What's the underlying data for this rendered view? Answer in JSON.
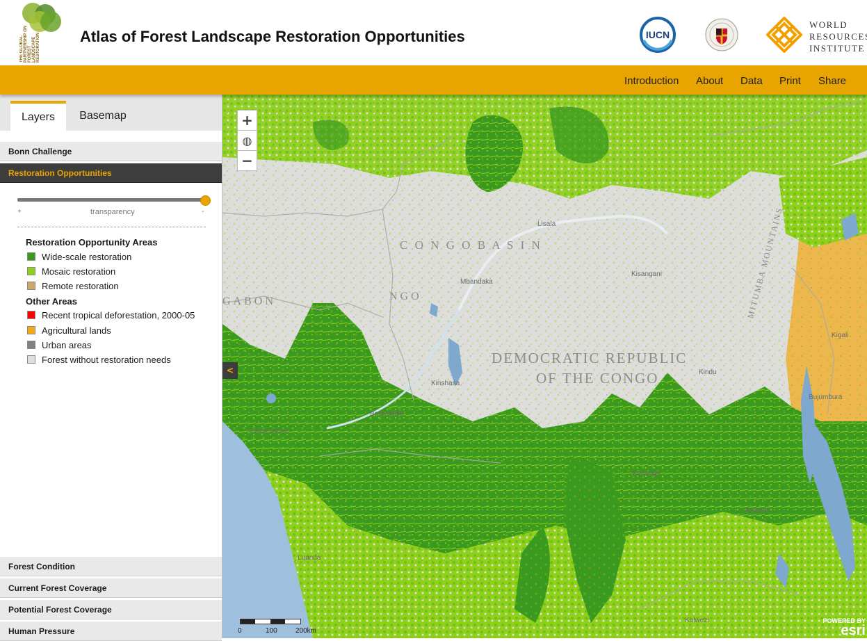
{
  "header": {
    "title": "Atlas of Forest Landscape Restoration Opportunities",
    "partner_logo_text": "THE GLOBAL PARTNERSHIP ON FOREST LANDSCAPE RESTORATION",
    "iucn_text": "IUCN",
    "wri_lines": [
      "WORLD",
      "RESOURCES",
      "INSTITUTE"
    ]
  },
  "nav": [
    "Introduction",
    "About",
    "Data",
    "Print",
    "Share"
  ],
  "sidebar": {
    "tabs": [
      "Layers",
      "Basemap"
    ],
    "active_tab": "Layers",
    "sections_top": [
      "Bonn Challenge",
      "Restoration Opportunities"
    ],
    "active_section": "Restoration Opportunities",
    "sections_bottom": [
      "Forest Condition",
      "Current Forest Coverage",
      "Potential Forest Coverage",
      "Human Pressure"
    ],
    "slider": {
      "plus": "+",
      "label": "transparency",
      "minus": "-",
      "value": 1.0
    },
    "legend": {
      "heading1": "Restoration Opportunity Areas",
      "group1": [
        {
          "label": "Wide-scale restoration",
          "color": "#3a9a1f"
        },
        {
          "label": "Mosaic restoration",
          "color": "#8fd11a"
        },
        {
          "label": "Remote restoration",
          "color": "#c8a96a"
        }
      ],
      "heading2": "Other Areas",
      "group2": [
        {
          "label": "Recent tropical deforestation, 2000-05",
          "color": "#ff0000"
        },
        {
          "label": "Agricultural lands",
          "color": "#f3a91d"
        },
        {
          "label": "Urban areas",
          "color": "#808080"
        },
        {
          "label": "Forest without restoration needs",
          "color": "#dedede"
        }
      ]
    }
  },
  "map": {
    "zoom_in": "+",
    "globe": "◍",
    "zoom_out": "−",
    "collapse": "<",
    "labels": {
      "congo_basin": "C O N G O   B A S I N",
      "drc_line1": "DEMOCRATIC REPUBLIC",
      "drc_line2": "OF THE CONGO",
      "gabon": "GABON",
      "congo": "NGO",
      "mitumba": "MITUMBA MOUNTAINS"
    },
    "cities": [
      "Lisala",
      "Mbandaka",
      "Kisangani",
      "Kindu",
      "Kigali",
      "Bujumbura",
      "Brazzaville",
      "Kinshasa",
      "Pointe-Noire",
      "Luanda",
      "Kananga",
      "Kalemie",
      "Kolwezi"
    ],
    "scale": [
      "0",
      "100",
      "200km"
    ],
    "attribution": [
      "POWERED BY",
      "esri"
    ]
  },
  "colors": {
    "accent": "#e8a400",
    "wide_scale": "#3a9a1f",
    "mosaic": "#8fd11a",
    "agricultural": "#f3a91d",
    "water": "#7fa8cf"
  }
}
